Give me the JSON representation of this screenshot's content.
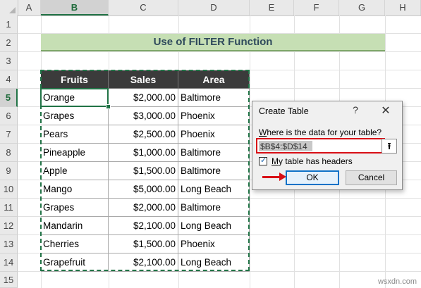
{
  "columns": [
    "A",
    "B",
    "C",
    "D",
    "E",
    "F",
    "G",
    "H"
  ],
  "rows": [
    "1",
    "2",
    "3",
    "4",
    "5",
    "6",
    "7",
    "8",
    "9",
    "10",
    "11",
    "12",
    "13",
    "14",
    "15"
  ],
  "title": "Use of FILTER Function",
  "table": {
    "headers": [
      "Fruits",
      "Sales",
      "Area"
    ],
    "rows": [
      [
        "Orange",
        "$2,000.00",
        "Baltimore"
      ],
      [
        "Grapes",
        "$3,000.00",
        "Phoenix"
      ],
      [
        "Pears",
        "$2,500.00",
        "Phoenix"
      ],
      [
        "Pineapple",
        "$1,000.00",
        "Baltimore"
      ],
      [
        "Apple",
        "$1,500.00",
        "Baltimore"
      ],
      [
        "Mango",
        "$5,000.00",
        "Long Beach"
      ],
      [
        "Grapes",
        "$2,000.00",
        "Baltimore"
      ],
      [
        "Mandarin",
        "$2,100.00",
        "Long Beach"
      ],
      [
        "Cherries",
        "$1,500.00",
        "Phoenix"
      ],
      [
        "Grapefruit",
        "$2,100.00",
        "Long Beach"
      ]
    ]
  },
  "dialog": {
    "title": "Create Table",
    "help": "?",
    "close": "✕",
    "prompt_u": "W",
    "prompt_rest": "here is the data for your table?",
    "range_value": "$B$4:$D$14",
    "collapse_glyph": "⭱",
    "checkbox_checked": true,
    "checkbox_mark": "✓",
    "checkbox_label_u": "M",
    "checkbox_label_rest": "y table has headers",
    "ok": "OK",
    "cancel": "Cancel"
  },
  "watermark": "wsxdn.com",
  "colors": {
    "title_fill": "#c6dfb4",
    "header_fill": "#3b3b3b",
    "selection": "#217346",
    "highlight_red": "#d80f16",
    "ok_border": "#0e72c8"
  }
}
